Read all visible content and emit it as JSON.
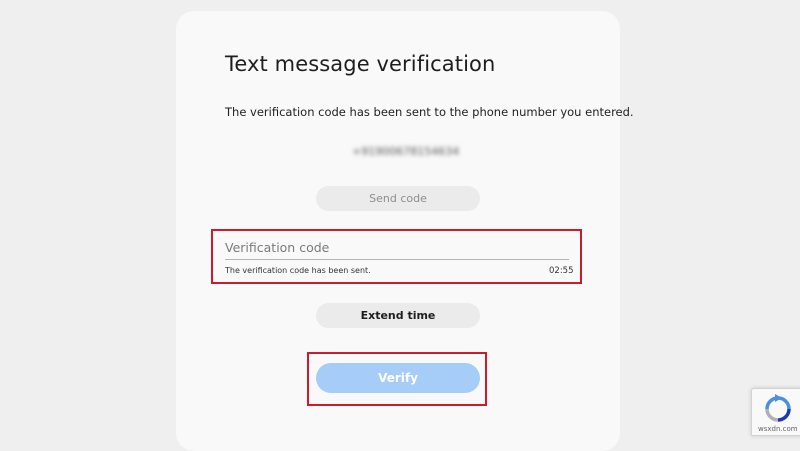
{
  "page": {
    "title": "Text message verification",
    "description": "The verification code has been sent to the phone number you entered.",
    "phone_number": "+91900678154634"
  },
  "send_code": {
    "label": "Send code"
  },
  "verification": {
    "placeholder": "Verification code",
    "status_message": "The verification code has been sent.",
    "timer": "02:55"
  },
  "extend_time": {
    "label": "Extend time"
  },
  "verify": {
    "label": "Verify"
  },
  "watermark": {
    "text": "wsxdn.com"
  },
  "colors": {
    "highlight": "#cc1b2b",
    "verify_button": "#a6cdf8",
    "pill_button": "#ebebeb",
    "recaptcha_blue": "#4a90e2"
  },
  "icons": {
    "recaptcha": "recaptcha-icon"
  }
}
